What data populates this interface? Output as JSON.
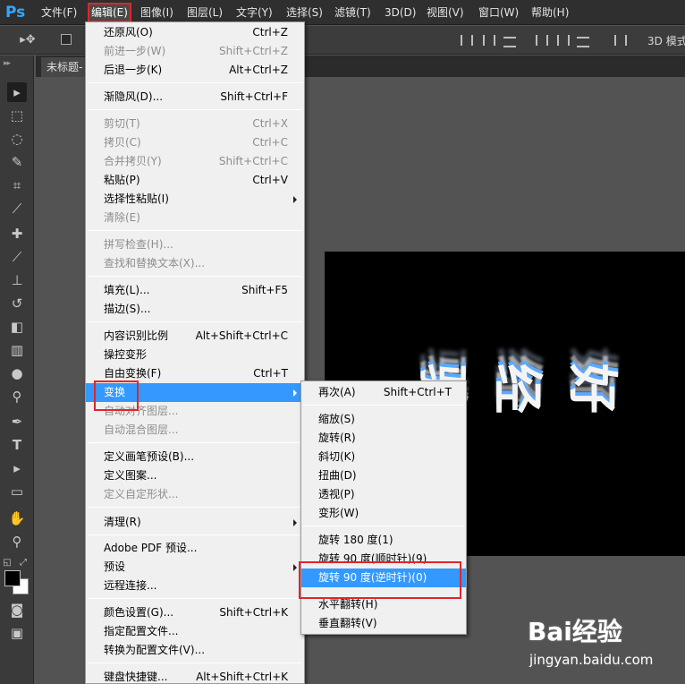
{
  "app": {
    "logo": "Ps"
  },
  "menubar": {
    "items": [
      "文件(F)",
      "编辑(E)",
      "图像(I)",
      "图层(L)",
      "文字(Y)",
      "选择(S)",
      "滤镜(T)",
      "3D(D)",
      "视图(V)",
      "窗口(W)",
      "帮助(H)"
    ],
    "active": "编辑(E)"
  },
  "options_bar": {
    "label_3d": "3D 模式"
  },
  "document_tab": {
    "title": "未标题-"
  },
  "canvas": {
    "art_text": "好\n经\n验"
  },
  "edit_menu": {
    "items": [
      {
        "label": "还原风(O)",
        "shortcut": "Ctrl+Z"
      },
      {
        "label": "前进一步(W)",
        "shortcut": "Shift+Ctrl+Z"
      },
      {
        "label": "后退一步(K)",
        "shortcut": "Alt+Ctrl+Z"
      },
      {
        "label": "渐隐风(D)...",
        "shortcut": "Shift+Ctrl+F"
      },
      {
        "label": "剪切(T)",
        "shortcut": "Ctrl+X"
      },
      {
        "label": "拷贝(C)",
        "shortcut": "Ctrl+C"
      },
      {
        "label": "合并拷贝(Y)",
        "shortcut": "Shift+Ctrl+C"
      },
      {
        "label": "粘贴(P)",
        "shortcut": "Ctrl+V"
      },
      {
        "label": "选择性粘贴(I)",
        "shortcut": ""
      },
      {
        "label": "清除(E)",
        "shortcut": ""
      },
      {
        "label": "拼写检查(H)...",
        "shortcut": ""
      },
      {
        "label": "查找和替换文本(X)...",
        "shortcut": ""
      },
      {
        "label": "填充(L)...",
        "shortcut": "Shift+F5"
      },
      {
        "label": "描边(S)...",
        "shortcut": ""
      },
      {
        "label": "内容识别比例",
        "shortcut": "Alt+Shift+Ctrl+C"
      },
      {
        "label": "操控变形",
        "shortcut": ""
      },
      {
        "label": "自由变换(F)",
        "shortcut": "Ctrl+T"
      },
      {
        "label": "变换",
        "shortcut": ""
      },
      {
        "label": "自动对齐图层...",
        "shortcut": ""
      },
      {
        "label": "自动混合图层...",
        "shortcut": ""
      },
      {
        "label": "定义画笔预设(B)...",
        "shortcut": ""
      },
      {
        "label": "定义图案...",
        "shortcut": ""
      },
      {
        "label": "定义自定形状...",
        "shortcut": ""
      },
      {
        "label": "清理(R)",
        "shortcut": ""
      },
      {
        "label": "Adobe PDF 预设...",
        "shortcut": ""
      },
      {
        "label": "预设",
        "shortcut": ""
      },
      {
        "label": "远程连接...",
        "shortcut": ""
      },
      {
        "label": "颜色设置(G)...",
        "shortcut": "Shift+Ctrl+K"
      },
      {
        "label": "指定配置文件...",
        "shortcut": ""
      },
      {
        "label": "转换为配置文件(V)...",
        "shortcut": ""
      },
      {
        "label": "键盘快捷键...",
        "shortcut": "Alt+Shift+Ctrl+K"
      }
    ]
  },
  "transform_submenu": {
    "items": [
      {
        "label": "再次(A)",
        "shortcut": "Shift+Ctrl+T"
      },
      {
        "label": "缩放(S)",
        "shortcut": ""
      },
      {
        "label": "旋转(R)",
        "shortcut": ""
      },
      {
        "label": "斜切(K)",
        "shortcut": ""
      },
      {
        "label": "扭曲(D)",
        "shortcut": ""
      },
      {
        "label": "透视(P)",
        "shortcut": ""
      },
      {
        "label": "变形(W)",
        "shortcut": ""
      },
      {
        "label": "旋转 180 度(1)",
        "shortcut": ""
      },
      {
        "label": "旋转 90 度(顺时针)(9)",
        "shortcut": ""
      },
      {
        "label": "旋转 90 度(逆时针)(0)",
        "shortcut": ""
      },
      {
        "label": "水平翻转(H)",
        "shortcut": ""
      },
      {
        "label": "垂直翻转(V)",
        "shortcut": ""
      }
    ]
  },
  "watermark": {
    "logo": "Bai经验",
    "url": "jingyan.baidu.com"
  },
  "colors": {
    "accent": "#3399ff",
    "highlight_box": "#e0262a",
    "ps_blue": "#31a8ff"
  }
}
